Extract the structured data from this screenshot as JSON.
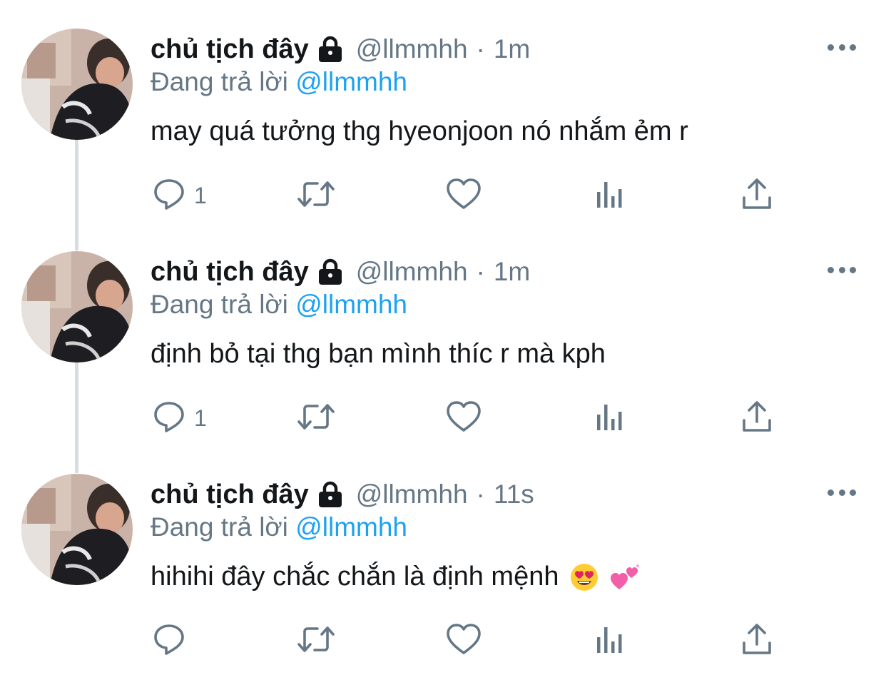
{
  "tweets": [
    {
      "name": "chủ tịch đây",
      "lock_icon": "lock-icon",
      "handle": "@llmmhh",
      "separator": "·",
      "time": "1m",
      "reply_prefix": "Đang trả lời",
      "reply_to": "@llmmhh",
      "text": "may quá tưởng thg hyeonjoon nó nhắm ẻm r",
      "emojis": [],
      "reply_count": "1"
    },
    {
      "name": "chủ tịch đây",
      "lock_icon": "lock-icon",
      "handle": "@llmmhh",
      "separator": "·",
      "time": "1m",
      "reply_prefix": "Đang trả lời",
      "reply_to": "@llmmhh",
      "text": "định bỏ tại thg bạn mình thíc r mà kph",
      "emojis": [],
      "reply_count": "1"
    },
    {
      "name": "chủ tịch đây",
      "lock_icon": "lock-icon",
      "handle": "@llmmhh",
      "separator": "·",
      "time": "11s",
      "reply_prefix": "Đang trả lời",
      "reply_to": "@llmmhh",
      "text": "hihihi đây chắc chắn là định mệnh",
      "emojis": [
        "smiling-face-with-heart-eyes-emoji",
        "two-hearts-emoji"
      ],
      "reply_count": ""
    }
  ],
  "icons": {
    "reply": "reply-icon",
    "retweet": "retweet-icon",
    "like": "like-icon",
    "analytics": "analytics-icon",
    "share": "share-icon",
    "more": "more-icon"
  },
  "colors": {
    "text": "#14171a",
    "secondary": "#657786",
    "link": "#1da1f2",
    "thread_line": "#d8dde1"
  }
}
